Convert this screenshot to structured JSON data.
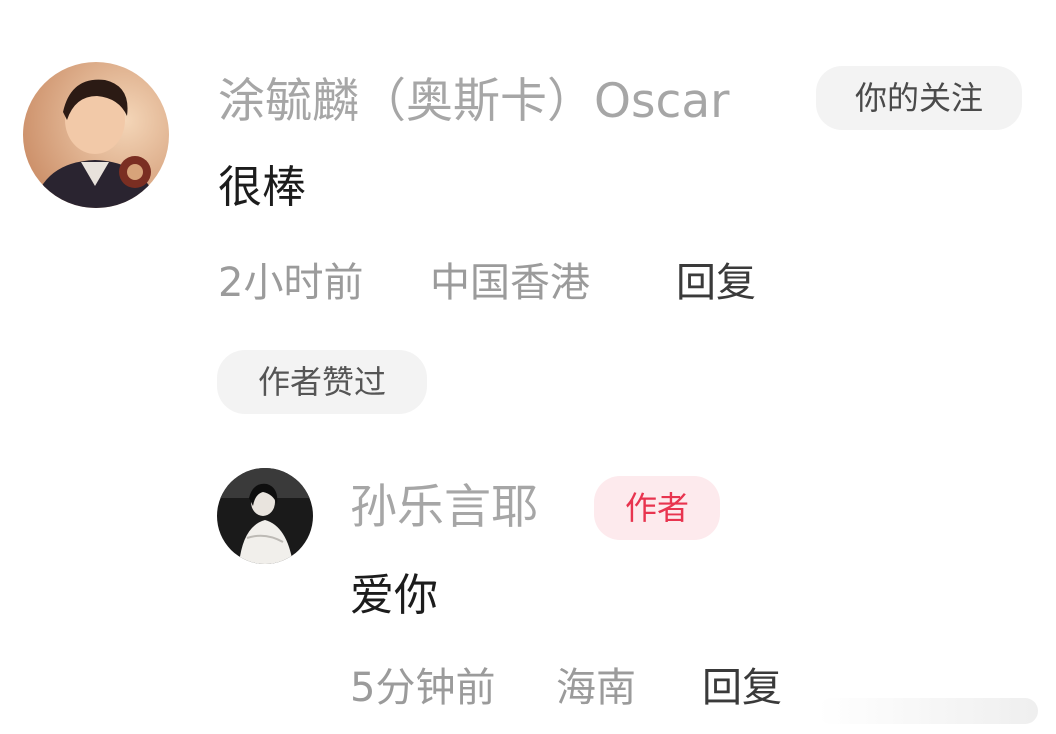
{
  "comment": {
    "username": "涂毓麟（奥斯卡）Oscar",
    "follow_badge": "你的关注",
    "text": "很棒",
    "time": "2小时前",
    "location": "中国香港",
    "reply_label": "回复",
    "liked_by_author": "作者赞过"
  },
  "reply": {
    "username": "孙乐言耶",
    "author_badge": "作者",
    "text": "爱你",
    "time": "5分钟前",
    "location": "海南",
    "reply_label": "回复"
  },
  "colors": {
    "author_badge_text": "#e8344f",
    "author_badge_bg": "#fdeaed",
    "muted_text": "#a6a6a6"
  }
}
